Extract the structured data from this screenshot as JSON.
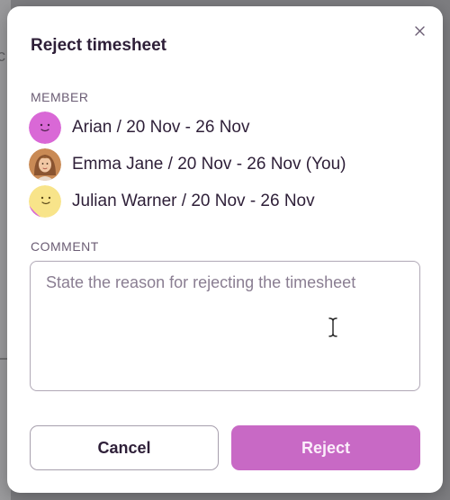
{
  "dialog": {
    "title": "Reject timesheet",
    "close_icon": "close-icon",
    "member_label": "MEMBER",
    "members": [
      {
        "text": "Arian / 20 Nov  -  26 Nov",
        "avatar": "smiley-avatar-pink",
        "color": "#d968d6"
      },
      {
        "text": "Emma Jane / 20 Nov  -  26 Nov (You)",
        "avatar": "photo-avatar",
        "color": "#c98a55"
      },
      {
        "text": "Julian Warner / 20 Nov  -  26 Nov",
        "avatar": "smiley-avatar-yellow",
        "color": "#f8e48a"
      }
    ],
    "comment_label": "COMMENT",
    "comment_placeholder": "State the reason for rejecting the timesheet",
    "comment_value": "",
    "cancel_label": "Cancel",
    "reject_label": "Reject",
    "accent_color": "#c869c5"
  },
  "backdrop": {
    "partial_letter": "c"
  }
}
